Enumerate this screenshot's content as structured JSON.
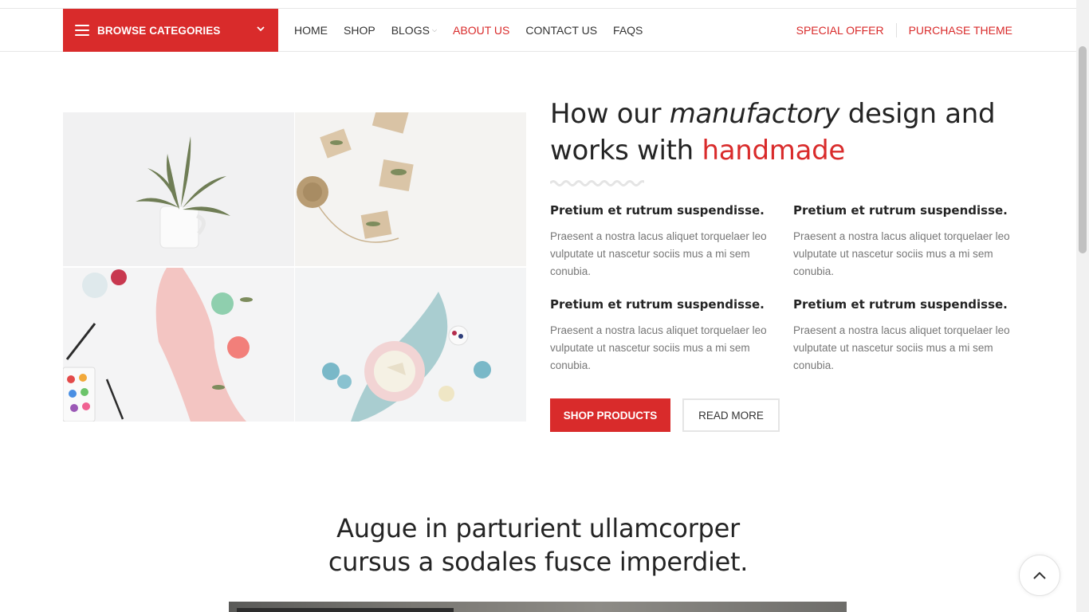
{
  "nav": {
    "browse_label": "BROWSE CATEGORIES",
    "items": [
      {
        "label": "HOME"
      },
      {
        "label": "SHOP"
      },
      {
        "label": "BLOGS"
      },
      {
        "label": "ABOUT US"
      },
      {
        "label": "CONTACT US"
      },
      {
        "label": "FAQS"
      }
    ],
    "special_offer": "SPECIAL OFFER",
    "purchase_theme": "PURCHASE THEME"
  },
  "hero": {
    "headline_part1": "How our ",
    "headline_italic": "manufactory",
    "headline_part2": " design and works with ",
    "headline_accent": "handmade"
  },
  "features": [
    {
      "title": "Pretium et rutrum suspendisse.",
      "text": "Praesent a nostra lacus aliquet torquelaer leo vulputate ut nascetur sociis mus a mi sem conubia."
    },
    {
      "title": "Pretium et rutrum suspendisse.",
      "text": "Praesent a nostra lacus aliquet torquelaer leo vulputate ut nascetur sociis mus a mi sem conubia."
    },
    {
      "title": "Pretium et rutrum suspendisse.",
      "text": "Praesent a nostra lacus aliquet torquelaer leo vulputate ut nascetur sociis mus a mi sem conubia."
    },
    {
      "title": "Pretium et rutrum suspendisse.",
      "text": "Praesent a nostra lacus aliquet torquelaer leo vulputate ut nascetur sociis mus a mi sem conubia."
    }
  ],
  "buttons": {
    "shop_products": "SHOP PRODUCTS",
    "read_more": "READ MORE"
  },
  "section2": {
    "line1": "Augue in parturient ullamcorper",
    "line2": "cursus a sodales fusce imperdiet."
  },
  "colors": {
    "accent": "#d92b2b",
    "text": "#242424",
    "muted": "#777777"
  },
  "icons": {
    "browse": "hamburger-menu-icon",
    "dropdown": "chevron-down-icon",
    "scroll_top": "chevron-up-icon"
  }
}
